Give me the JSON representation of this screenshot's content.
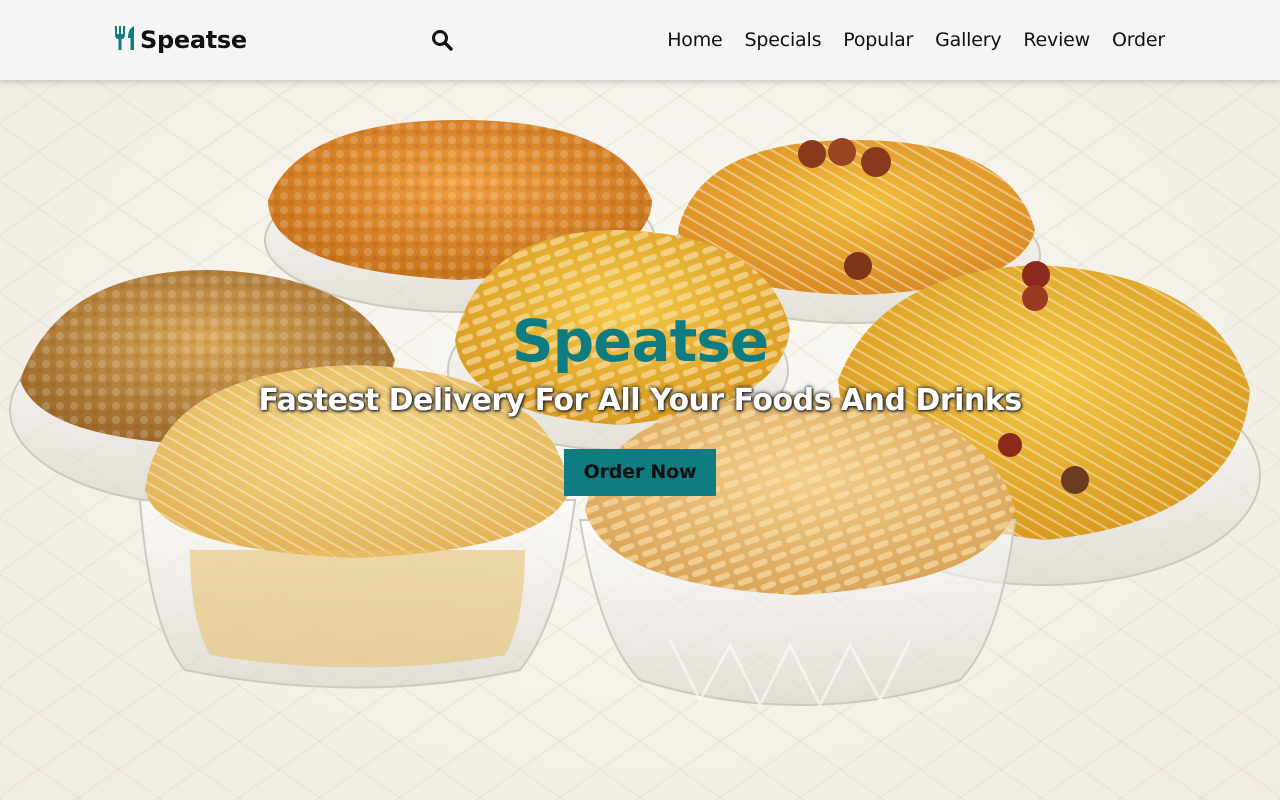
{
  "brand": {
    "name": "Speatse",
    "logo_icon": "utensils-icon",
    "accent_color": "#0e7c80"
  },
  "header": {
    "search_icon": "search-icon",
    "nav": [
      {
        "label": "Home"
      },
      {
        "label": "Specials"
      },
      {
        "label": "Popular"
      },
      {
        "label": "Gallery"
      },
      {
        "label": "Review"
      },
      {
        "label": "Order"
      }
    ]
  },
  "hero": {
    "title": "Speatse",
    "subtitle": "Fastest Delivery For All Your Foods And Drinks",
    "cta_label": "Order Now",
    "background": "bowls of assorted snacks"
  }
}
